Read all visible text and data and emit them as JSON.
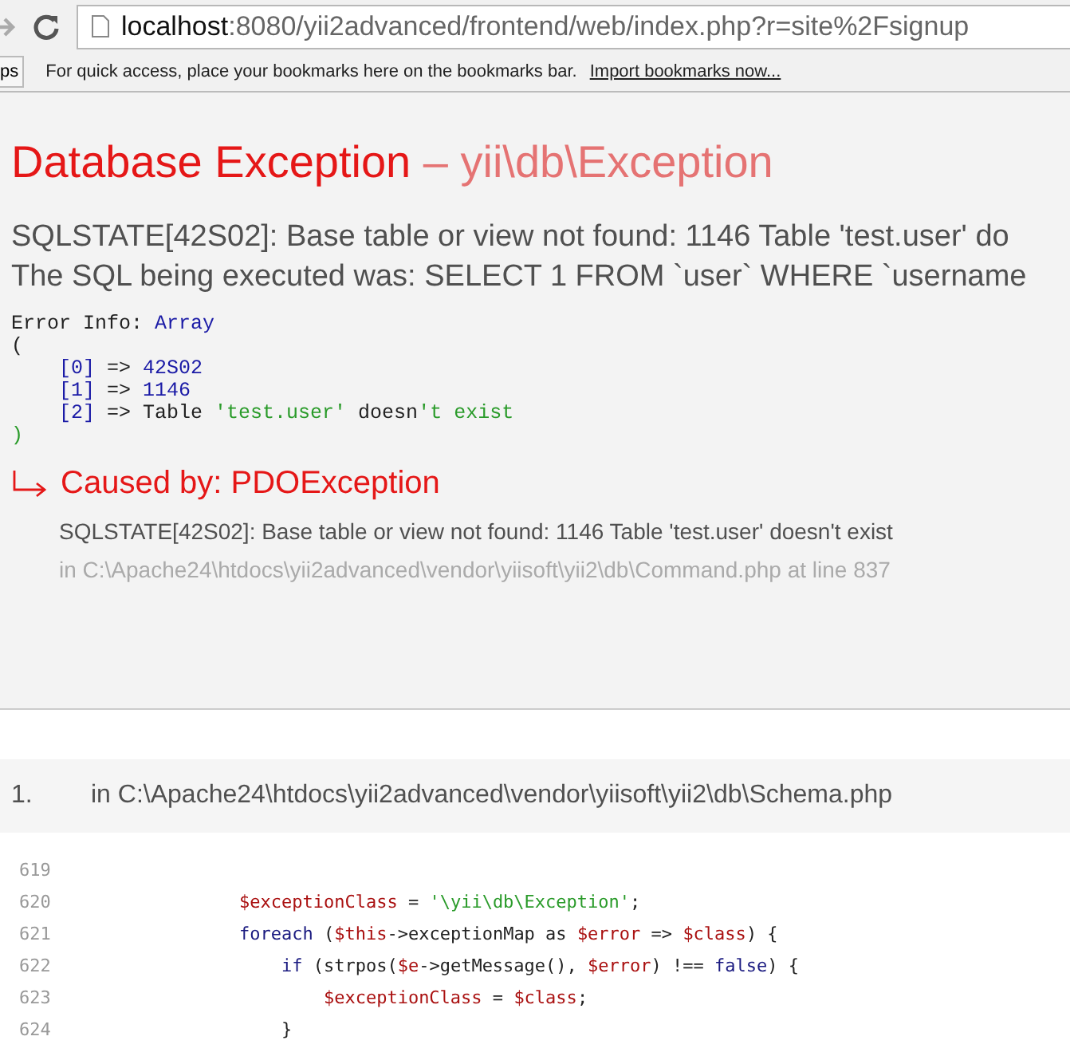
{
  "browser": {
    "address": {
      "host": "localhost",
      "path": ":8080/yii2advanced/frontend/web/index.php?r=site%2Fsignup"
    },
    "apps_button": "ps",
    "bookmarks_hint": "For quick access, place your bookmarks here on the bookmarks bar.",
    "import_link": "Import bookmarks now..."
  },
  "exception": {
    "title": "Database Exception",
    "subtitle": "– yii\\db\\Exception",
    "message_lines": [
      "SQLSTATE[42S02]: Base table or view not found: 1146 Table 'test.user' do",
      "The SQL being executed was: SELECT 1 FROM `user` WHERE `username"
    ],
    "error_info": [
      [
        {
          "text": "Error Info: ",
          "kind": "plain"
        },
        {
          "text": "Array",
          "kind": "key"
        }
      ],
      [
        {
          "text": "(",
          "kind": "plain"
        }
      ],
      [
        {
          "text": "    [0]",
          "kind": "key"
        },
        {
          "text": " => ",
          "kind": "plain"
        },
        {
          "text": "42S02",
          "kind": "key"
        }
      ],
      [
        {
          "text": "    [1]",
          "kind": "key"
        },
        {
          "text": " => ",
          "kind": "plain"
        },
        {
          "text": "1146",
          "kind": "key"
        }
      ],
      [
        {
          "text": "    [2]",
          "kind": "key"
        },
        {
          "text": " => Table ",
          "kind": "plain"
        },
        {
          "text": "'test.user'",
          "kind": "string"
        },
        {
          "text": " doesn",
          "kind": "plain"
        },
        {
          "text": "'t exist",
          "kind": "string"
        }
      ],
      [
        {
          "text": ")",
          "kind": "string"
        }
      ]
    ],
    "caused_by": {
      "title": "Caused by: PDOException",
      "message": "SQLSTATE[42S02]: Base table or view not found: 1146 Table 'test.user' doesn't exist",
      "location": "in C:\\Apache24\\htdocs\\yii2advanced\\vendor\\yiisoft\\yii2\\db\\Command.php at line 837"
    }
  },
  "call_stack": [
    {
      "number": "1.",
      "location": "in C:\\Apache24\\htdocs\\yii2advanced\\vendor\\yiisoft\\yii2\\db\\Schema.php",
      "code_lines": [
        {
          "number": "619"
        },
        {
          "number": "620",
          "tokens": [
            {
              "text": "        $exceptionClass",
              "kind": "var"
            },
            {
              "text": " = ",
              "kind": "plain"
            },
            {
              "text": "'\\yii\\db\\Exception'",
              "kind": "string"
            },
            {
              "text": ";",
              "kind": "plain"
            }
          ]
        },
        {
          "number": "621",
          "tokens": [
            {
              "text": "        foreach",
              "kind": "keyword"
            },
            {
              "text": " (",
              "kind": "plain"
            },
            {
              "text": "$this",
              "kind": "var"
            },
            {
              "text": "->exceptionMap as ",
              "kind": "plain"
            },
            {
              "text": "$error",
              "kind": "var"
            },
            {
              "text": " => ",
              "kind": "plain"
            },
            {
              "text": "$class",
              "kind": "var"
            },
            {
              "text": ") {",
              "kind": "plain"
            }
          ]
        },
        {
          "number": "622",
          "tokens": [
            {
              "text": "            if",
              "kind": "keyword"
            },
            {
              "text": " (strpos(",
              "kind": "plain"
            },
            {
              "text": "$e",
              "kind": "var"
            },
            {
              "text": "->getMessage(), ",
              "kind": "plain"
            },
            {
              "text": "$error",
              "kind": "var"
            },
            {
              "text": ") !== ",
              "kind": "plain"
            },
            {
              "text": "false",
              "kind": "keyword"
            },
            {
              "text": ") {",
              "kind": "plain"
            }
          ]
        },
        {
          "number": "623",
          "tokens": [
            {
              "text": "                $exceptionClass",
              "kind": "var"
            },
            {
              "text": " = ",
              "kind": "plain"
            },
            {
              "text": "$class",
              "kind": "var"
            },
            {
              "text": ";",
              "kind": "plain"
            }
          ]
        },
        {
          "number": "624",
          "tokens": [
            {
              "text": "            }",
              "kind": "plain"
            }
          ]
        }
      ]
    }
  ]
}
